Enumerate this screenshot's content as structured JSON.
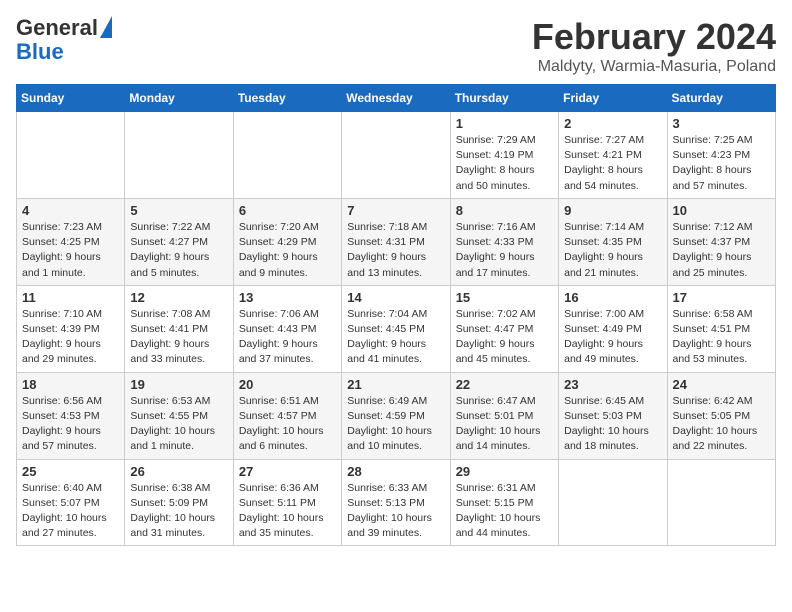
{
  "header": {
    "logo_line1": "General",
    "logo_line2": "Blue",
    "title": "February 2024",
    "subtitle": "Maldyty, Warmia-Masuria, Poland"
  },
  "days_of_week": [
    "Sunday",
    "Monday",
    "Tuesday",
    "Wednesday",
    "Thursday",
    "Friday",
    "Saturday"
  ],
  "weeks": [
    [
      {
        "day": "",
        "content": ""
      },
      {
        "day": "",
        "content": ""
      },
      {
        "day": "",
        "content": ""
      },
      {
        "day": "",
        "content": ""
      },
      {
        "day": "1",
        "content": "Sunrise: 7:29 AM\nSunset: 4:19 PM\nDaylight: 8 hours\nand 50 minutes."
      },
      {
        "day": "2",
        "content": "Sunrise: 7:27 AM\nSunset: 4:21 PM\nDaylight: 8 hours\nand 54 minutes."
      },
      {
        "day": "3",
        "content": "Sunrise: 7:25 AM\nSunset: 4:23 PM\nDaylight: 8 hours\nand 57 minutes."
      }
    ],
    [
      {
        "day": "4",
        "content": "Sunrise: 7:23 AM\nSunset: 4:25 PM\nDaylight: 9 hours\nand 1 minute."
      },
      {
        "day": "5",
        "content": "Sunrise: 7:22 AM\nSunset: 4:27 PM\nDaylight: 9 hours\nand 5 minutes."
      },
      {
        "day": "6",
        "content": "Sunrise: 7:20 AM\nSunset: 4:29 PM\nDaylight: 9 hours\nand 9 minutes."
      },
      {
        "day": "7",
        "content": "Sunrise: 7:18 AM\nSunset: 4:31 PM\nDaylight: 9 hours\nand 13 minutes."
      },
      {
        "day": "8",
        "content": "Sunrise: 7:16 AM\nSunset: 4:33 PM\nDaylight: 9 hours\nand 17 minutes."
      },
      {
        "day": "9",
        "content": "Sunrise: 7:14 AM\nSunset: 4:35 PM\nDaylight: 9 hours\nand 21 minutes."
      },
      {
        "day": "10",
        "content": "Sunrise: 7:12 AM\nSunset: 4:37 PM\nDaylight: 9 hours\nand 25 minutes."
      }
    ],
    [
      {
        "day": "11",
        "content": "Sunrise: 7:10 AM\nSunset: 4:39 PM\nDaylight: 9 hours\nand 29 minutes."
      },
      {
        "day": "12",
        "content": "Sunrise: 7:08 AM\nSunset: 4:41 PM\nDaylight: 9 hours\nand 33 minutes."
      },
      {
        "day": "13",
        "content": "Sunrise: 7:06 AM\nSunset: 4:43 PM\nDaylight: 9 hours\nand 37 minutes."
      },
      {
        "day": "14",
        "content": "Sunrise: 7:04 AM\nSunset: 4:45 PM\nDaylight: 9 hours\nand 41 minutes."
      },
      {
        "day": "15",
        "content": "Sunrise: 7:02 AM\nSunset: 4:47 PM\nDaylight: 9 hours\nand 45 minutes."
      },
      {
        "day": "16",
        "content": "Sunrise: 7:00 AM\nSunset: 4:49 PM\nDaylight: 9 hours\nand 49 minutes."
      },
      {
        "day": "17",
        "content": "Sunrise: 6:58 AM\nSunset: 4:51 PM\nDaylight: 9 hours\nand 53 minutes."
      }
    ],
    [
      {
        "day": "18",
        "content": "Sunrise: 6:56 AM\nSunset: 4:53 PM\nDaylight: 9 hours\nand 57 minutes."
      },
      {
        "day": "19",
        "content": "Sunrise: 6:53 AM\nSunset: 4:55 PM\nDaylight: 10 hours\nand 1 minute."
      },
      {
        "day": "20",
        "content": "Sunrise: 6:51 AM\nSunset: 4:57 PM\nDaylight: 10 hours\nand 6 minutes."
      },
      {
        "day": "21",
        "content": "Sunrise: 6:49 AM\nSunset: 4:59 PM\nDaylight: 10 hours\nand 10 minutes."
      },
      {
        "day": "22",
        "content": "Sunrise: 6:47 AM\nSunset: 5:01 PM\nDaylight: 10 hours\nand 14 minutes."
      },
      {
        "day": "23",
        "content": "Sunrise: 6:45 AM\nSunset: 5:03 PM\nDaylight: 10 hours\nand 18 minutes."
      },
      {
        "day": "24",
        "content": "Sunrise: 6:42 AM\nSunset: 5:05 PM\nDaylight: 10 hours\nand 22 minutes."
      }
    ],
    [
      {
        "day": "25",
        "content": "Sunrise: 6:40 AM\nSunset: 5:07 PM\nDaylight: 10 hours\nand 27 minutes."
      },
      {
        "day": "26",
        "content": "Sunrise: 6:38 AM\nSunset: 5:09 PM\nDaylight: 10 hours\nand 31 minutes."
      },
      {
        "day": "27",
        "content": "Sunrise: 6:36 AM\nSunset: 5:11 PM\nDaylight: 10 hours\nand 35 minutes."
      },
      {
        "day": "28",
        "content": "Sunrise: 6:33 AM\nSunset: 5:13 PM\nDaylight: 10 hours\nand 39 minutes."
      },
      {
        "day": "29",
        "content": "Sunrise: 6:31 AM\nSunset: 5:15 PM\nDaylight: 10 hours\nand 44 minutes."
      },
      {
        "day": "",
        "content": ""
      },
      {
        "day": "",
        "content": ""
      }
    ]
  ]
}
